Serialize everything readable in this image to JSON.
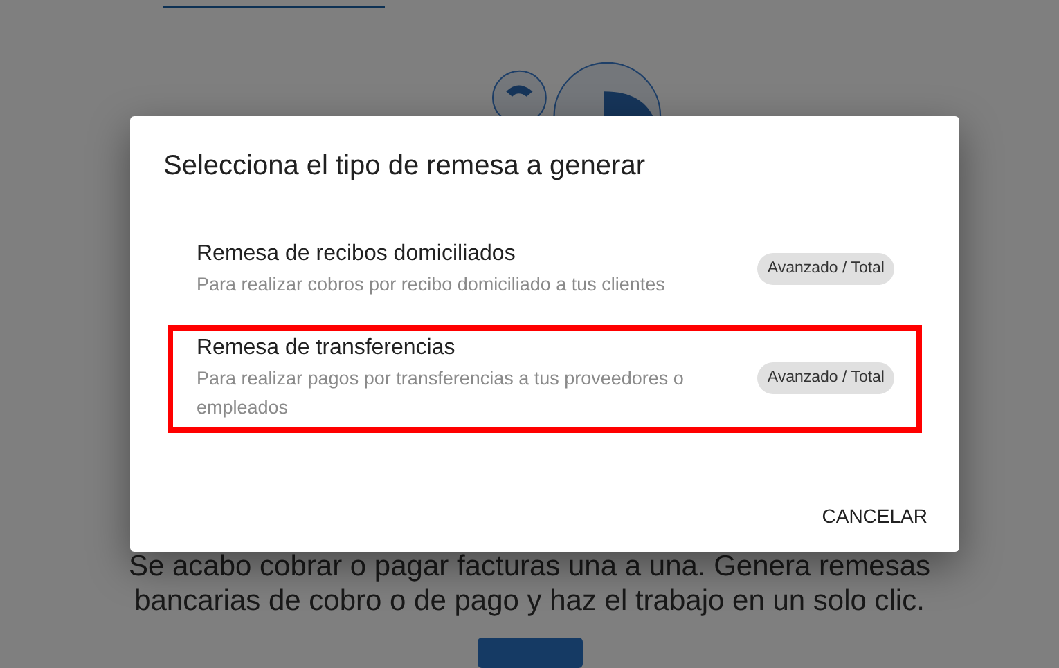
{
  "page": {
    "paragraph_lines": [
      "Se acabo cobrar o pagar facturas una a una. Genera remesas",
      "bancarias de cobro o de pago y haz el trabajo en un solo clic."
    ]
  },
  "dialog": {
    "title": "Selecciona el tipo de remesa a generar",
    "options": [
      {
        "title": "Remesa de recibos domiciliados",
        "description": "Para realizar cobros por recibo domiciliado a tus clientes",
        "badge": "Avanzado / Total",
        "highlighted": false
      },
      {
        "title": "Remesa de transferencias",
        "description": "Para realizar pagos por transferencias a tus proveedores o empleados",
        "badge": "Avanzado / Total",
        "highlighted": true
      }
    ],
    "buttons": [
      "CANCELAR"
    ]
  }
}
